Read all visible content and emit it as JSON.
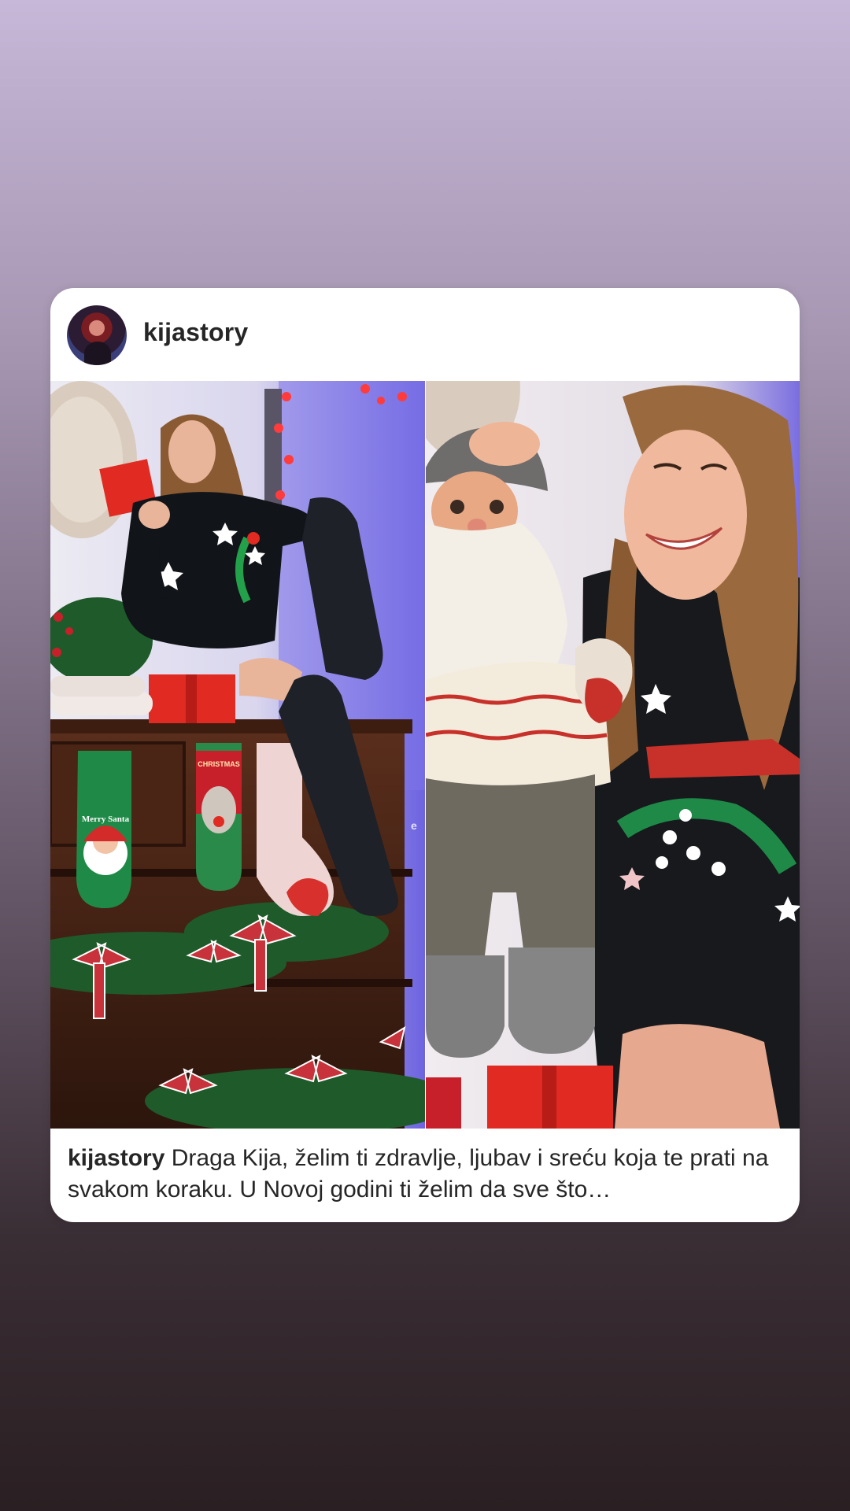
{
  "post": {
    "username": "kijastory",
    "caption_username": "kijastory",
    "caption_text": "Draga Kija, želim ti zdravlje, ljubav i sreću koja te prati na svakom koraku. U Novoj godini ti želim da sve što…",
    "avatar_icon": "profile-avatar",
    "sock_text": "Merry Santa",
    "sock_label": "CHRISTMAS"
  },
  "colors": {
    "bg_top": "#c7b7d8",
    "bg_bottom": "#2a1f22",
    "card": "#ffffff",
    "text": "#262626",
    "accent_red": "#e02a22",
    "accent_green": "#1f7a3a"
  }
}
